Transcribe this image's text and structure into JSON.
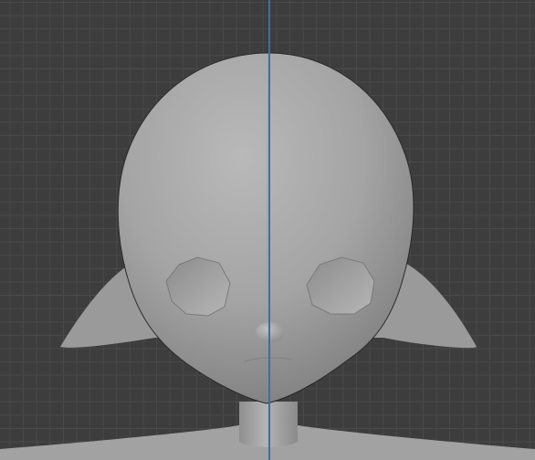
{
  "viewport": {
    "background_color": "#3d3d3d",
    "grid_color": "#4a4a4a",
    "z_axis_color": "#3c6ea8"
  },
  "model": {
    "mesh_base_color": "#a9a9a9",
    "shadow_silhouette_color": "#9a9a9a"
  }
}
